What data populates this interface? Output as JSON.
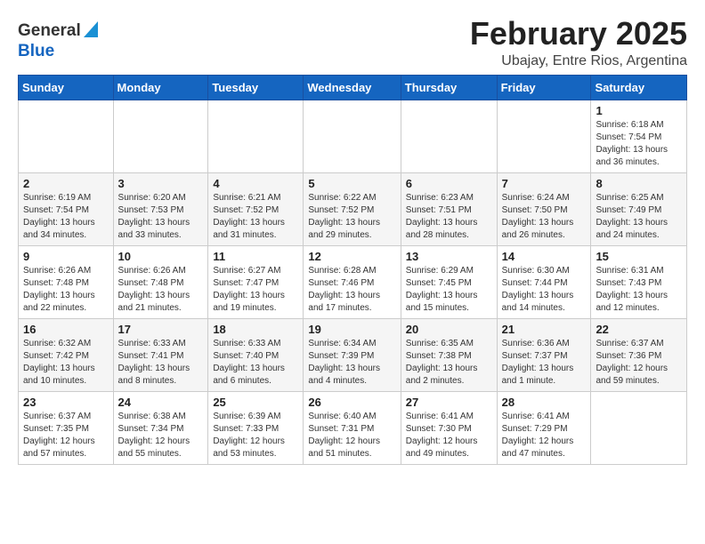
{
  "header": {
    "logo": {
      "general": "General",
      "blue": "Blue"
    },
    "title": "February 2025",
    "location": "Ubajay, Entre Rios, Argentina"
  },
  "calendar": {
    "days_of_week": [
      "Sunday",
      "Monday",
      "Tuesday",
      "Wednesday",
      "Thursday",
      "Friday",
      "Saturday"
    ],
    "weeks": [
      [
        {
          "day": "",
          "info": ""
        },
        {
          "day": "",
          "info": ""
        },
        {
          "day": "",
          "info": ""
        },
        {
          "day": "",
          "info": ""
        },
        {
          "day": "",
          "info": ""
        },
        {
          "day": "",
          "info": ""
        },
        {
          "day": "1",
          "info": "Sunrise: 6:18 AM\nSunset: 7:54 PM\nDaylight: 13 hours\nand 36 minutes."
        }
      ],
      [
        {
          "day": "2",
          "info": "Sunrise: 6:19 AM\nSunset: 7:54 PM\nDaylight: 13 hours\nand 34 minutes."
        },
        {
          "day": "3",
          "info": "Sunrise: 6:20 AM\nSunset: 7:53 PM\nDaylight: 13 hours\nand 33 minutes."
        },
        {
          "day": "4",
          "info": "Sunrise: 6:21 AM\nSunset: 7:52 PM\nDaylight: 13 hours\nand 31 minutes."
        },
        {
          "day": "5",
          "info": "Sunrise: 6:22 AM\nSunset: 7:52 PM\nDaylight: 13 hours\nand 29 minutes."
        },
        {
          "day": "6",
          "info": "Sunrise: 6:23 AM\nSunset: 7:51 PM\nDaylight: 13 hours\nand 28 minutes."
        },
        {
          "day": "7",
          "info": "Sunrise: 6:24 AM\nSunset: 7:50 PM\nDaylight: 13 hours\nand 26 minutes."
        },
        {
          "day": "8",
          "info": "Sunrise: 6:25 AM\nSunset: 7:49 PM\nDaylight: 13 hours\nand 24 minutes."
        }
      ],
      [
        {
          "day": "9",
          "info": "Sunrise: 6:26 AM\nSunset: 7:48 PM\nDaylight: 13 hours\nand 22 minutes."
        },
        {
          "day": "10",
          "info": "Sunrise: 6:26 AM\nSunset: 7:48 PM\nDaylight: 13 hours\nand 21 minutes."
        },
        {
          "day": "11",
          "info": "Sunrise: 6:27 AM\nSunset: 7:47 PM\nDaylight: 13 hours\nand 19 minutes."
        },
        {
          "day": "12",
          "info": "Sunrise: 6:28 AM\nSunset: 7:46 PM\nDaylight: 13 hours\nand 17 minutes."
        },
        {
          "day": "13",
          "info": "Sunrise: 6:29 AM\nSunset: 7:45 PM\nDaylight: 13 hours\nand 15 minutes."
        },
        {
          "day": "14",
          "info": "Sunrise: 6:30 AM\nSunset: 7:44 PM\nDaylight: 13 hours\nand 14 minutes."
        },
        {
          "day": "15",
          "info": "Sunrise: 6:31 AM\nSunset: 7:43 PM\nDaylight: 13 hours\nand 12 minutes."
        }
      ],
      [
        {
          "day": "16",
          "info": "Sunrise: 6:32 AM\nSunset: 7:42 PM\nDaylight: 13 hours\nand 10 minutes."
        },
        {
          "day": "17",
          "info": "Sunrise: 6:33 AM\nSunset: 7:41 PM\nDaylight: 13 hours\nand 8 minutes."
        },
        {
          "day": "18",
          "info": "Sunrise: 6:33 AM\nSunset: 7:40 PM\nDaylight: 13 hours\nand 6 minutes."
        },
        {
          "day": "19",
          "info": "Sunrise: 6:34 AM\nSunset: 7:39 PM\nDaylight: 13 hours\nand 4 minutes."
        },
        {
          "day": "20",
          "info": "Sunrise: 6:35 AM\nSunset: 7:38 PM\nDaylight: 13 hours\nand 2 minutes."
        },
        {
          "day": "21",
          "info": "Sunrise: 6:36 AM\nSunset: 7:37 PM\nDaylight: 13 hours\nand 1 minute."
        },
        {
          "day": "22",
          "info": "Sunrise: 6:37 AM\nSunset: 7:36 PM\nDaylight: 12 hours\nand 59 minutes."
        }
      ],
      [
        {
          "day": "23",
          "info": "Sunrise: 6:37 AM\nSunset: 7:35 PM\nDaylight: 12 hours\nand 57 minutes."
        },
        {
          "day": "24",
          "info": "Sunrise: 6:38 AM\nSunset: 7:34 PM\nDaylight: 12 hours\nand 55 minutes."
        },
        {
          "day": "25",
          "info": "Sunrise: 6:39 AM\nSunset: 7:33 PM\nDaylight: 12 hours\nand 53 minutes."
        },
        {
          "day": "26",
          "info": "Sunrise: 6:40 AM\nSunset: 7:31 PM\nDaylight: 12 hours\nand 51 minutes."
        },
        {
          "day": "27",
          "info": "Sunrise: 6:41 AM\nSunset: 7:30 PM\nDaylight: 12 hours\nand 49 minutes."
        },
        {
          "day": "28",
          "info": "Sunrise: 6:41 AM\nSunset: 7:29 PM\nDaylight: 12 hours\nand 47 minutes."
        },
        {
          "day": "",
          "info": ""
        }
      ]
    ]
  }
}
